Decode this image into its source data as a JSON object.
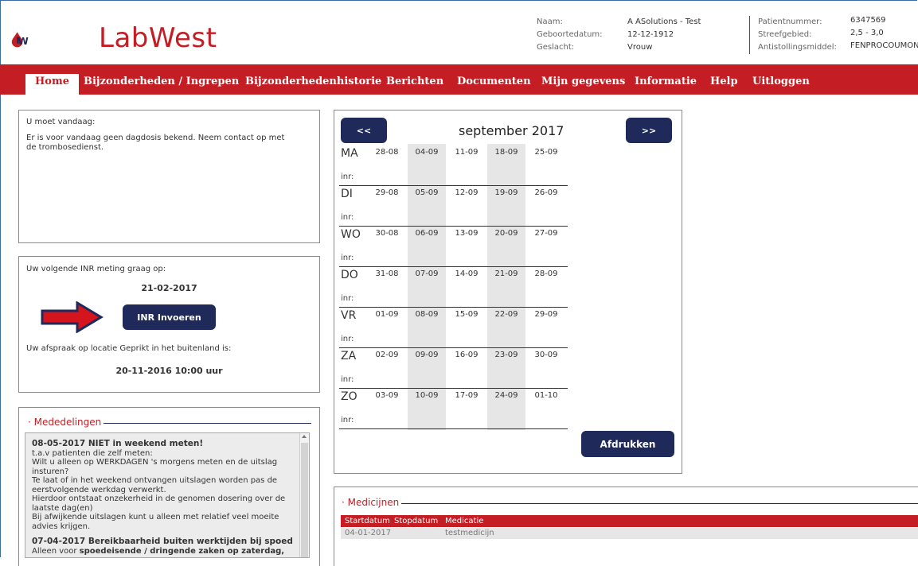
{
  "brand": {
    "name": "LabWest",
    "accent": "#c41d24",
    "navy": "#1f2a5a"
  },
  "patient": {
    "labels": [
      "Naam:",
      "Geboortedatum:",
      "Geslacht:"
    ],
    "values": [
      "A ASolutions - Test",
      "12-12-1912",
      "Vrouw"
    ],
    "labels2": [
      "Patientnummer:",
      "Streefgebied:",
      "Antistollingsmiddel:"
    ],
    "values2": [
      "6347569",
      "2,5 - 3,0",
      "FENPROCOUMON"
    ]
  },
  "nav": [
    "Home",
    "Bijzonderheden / Ingrepen",
    "Bijzonderhedenhistorie",
    "Berichten",
    "Documenten",
    "Mijn gegevens",
    "Informatie",
    "Help",
    "Uitloggen"
  ],
  "today": {
    "title": "U moet vandaag:",
    "text": "Er is voor vandaag geen dagdosis bekend. Neem contact op met de trombosedienst."
  },
  "next_inr": {
    "label": "Uw volgende INR meting graag op:",
    "date": "21-02-2017",
    "button": "INR Invoeren",
    "appointment_label": "Uw afspraak op locatie Geprikt in het buitenland is:",
    "appointment": "20-11-2016 10:00 uur"
  },
  "calendar": {
    "title": "september 2017",
    "prev": "<<",
    "next": ">>",
    "print": "Afdrukken",
    "inr_label": "inr:",
    "days": [
      "MA",
      "DI",
      "WO",
      "DO",
      "VR",
      "ZA",
      "ZO"
    ],
    "dates": [
      [
        "28-08",
        "04-09",
        "11-09",
        "18-09",
        "25-09"
      ],
      [
        "29-08",
        "05-09",
        "12-09",
        "19-09",
        "26-09"
      ],
      [
        "30-08",
        "06-09",
        "13-09",
        "20-09",
        "27-09"
      ],
      [
        "31-08",
        "07-09",
        "14-09",
        "21-09",
        "28-09"
      ],
      [
        "01-09",
        "08-09",
        "15-09",
        "22-09",
        "29-09"
      ],
      [
        "02-09",
        "09-09",
        "16-09",
        "23-09",
        "30-09"
      ],
      [
        "03-09",
        "10-09",
        "17-09",
        "24-09",
        "01-10"
      ]
    ]
  },
  "mededelingen": {
    "legend": "Mededelingen",
    "m1_title": "08-05-2017 NIET in weekend meten!",
    "m1_lines": [
      "t.a.v patienten die zelf meten:",
      "Wilt u alleen op WERKDAGEN 's morgens meten en de uitslag insturen?",
      "Te laat of in het weekend ontvangen uitslagen worden pas de eerstvolgende werkdag verwerkt.",
      "Hierdoor ontstaat onzekerheid in de genomen dosering over de laatste dag(en)",
      "Bij afwijkende uitslagen kunt u alleen met  relatief veel moeite advies krijgen."
    ],
    "m2_title": "07-04-2017 Bereikbaarheid buiten werktijden bij spoed",
    "m2_line_pre": "Alleen voor ",
    "m2_line_bold": "spoedeisende / dringende zaken op zaterdag,"
  },
  "medicijnen": {
    "legend": "Medicijnen",
    "headers": [
      "Startdatum",
      "Stopdatum",
      "Medicatie"
    ],
    "rows": [
      [
        "04-01-2017",
        "",
        "testmedicijn"
      ]
    ]
  }
}
